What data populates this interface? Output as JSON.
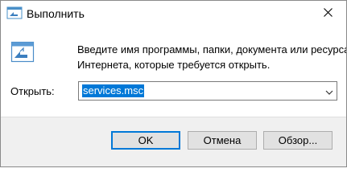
{
  "window": {
    "title": "Выполнить",
    "title_icon": "run-dialog-icon",
    "close_icon": "close-icon"
  },
  "main": {
    "icon": "run-dialog-icon",
    "description_line1": "Введите имя программы, папки, документа или ресурса",
    "description_line2": "Интернета, которые требуется открыть.",
    "open_label": "Открыть:",
    "open_value": "services.msc",
    "dropdown_icon": "chevron-down-icon"
  },
  "buttons": {
    "ok": "OK",
    "cancel": "Отмена",
    "browse": "Обзор..."
  },
  "colors": {
    "accent": "#0078d7",
    "footer_bg": "#f0f0f0",
    "button_bg": "#e1e1e1"
  }
}
